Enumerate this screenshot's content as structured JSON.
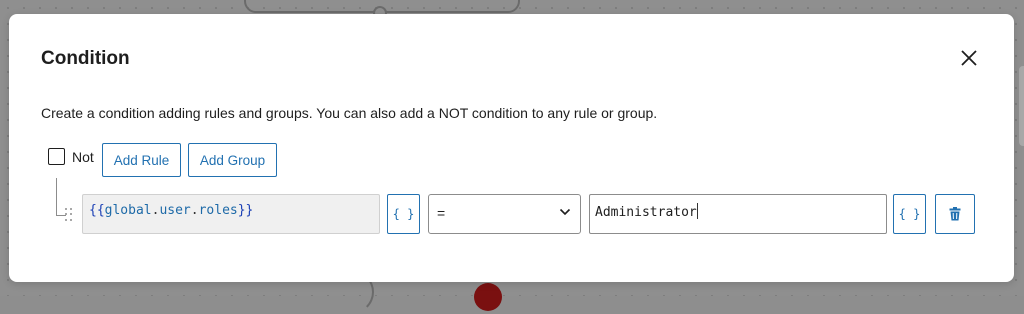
{
  "modal": {
    "title": "Condition",
    "description": "Create a condition adding rules and groups. You can also add a NOT condition to any rule or group."
  },
  "controls": {
    "not_label": "Not",
    "not_checked": false,
    "add_rule_label": "Add Rule",
    "add_group_label": "Add Group"
  },
  "rule": {
    "left_expression": {
      "open": "{{",
      "part1": "global",
      "dot1": ".",
      "part2": "user",
      "dot2": ".",
      "part3a": "roles",
      "close": "}}"
    },
    "variable_button_label": "{ }",
    "operator": "=",
    "value": "Administrator",
    "variable_button_2_label": "{ }"
  },
  "icons": {
    "close": "close-icon",
    "chevron": "chevron-down-icon",
    "trash": "trash-icon",
    "drag": "drag-handle-icon"
  },
  "colors": {
    "accent": "#2271b1",
    "text": "#1e1e1e"
  }
}
